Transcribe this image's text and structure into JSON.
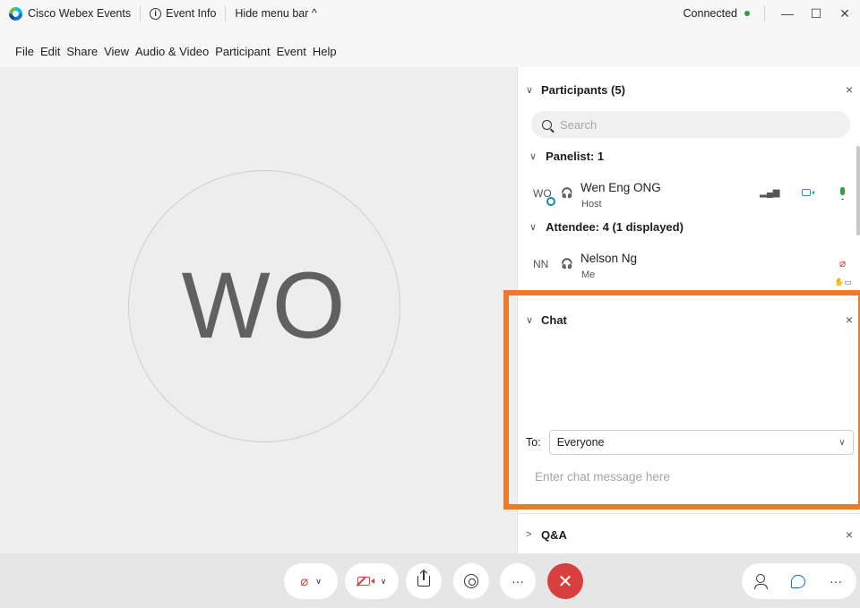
{
  "titlebar": {
    "app_name": "Cisco Webex Events",
    "event_info": "Event Info",
    "hide_menu": "Hide menu bar ^",
    "status": "Connected",
    "minimize": "—",
    "maximize": "☐",
    "close": "✕"
  },
  "menu": [
    "File",
    "Edit",
    "Share",
    "View",
    "Audio & Video",
    "Participant",
    "Event",
    "Help"
  ],
  "stage": {
    "avatar_initials": "WO"
  },
  "participants": {
    "title": "Participants (5)",
    "close": "×",
    "search_placeholder": "Search",
    "panelist_group": "Panelist: 1",
    "attendee_group": "Attendee: 4 (1 displayed)",
    "people": [
      {
        "initials": "WO",
        "name": "Wen Eng ONG",
        "role": "Host"
      },
      {
        "initials": "NN",
        "name": "Nelson Ng",
        "role": "Me"
      }
    ]
  },
  "chat": {
    "title": "Chat",
    "close": "×",
    "to_label": "To:",
    "to_value": "Everyone",
    "input_placeholder": "Enter chat message here"
  },
  "qa": {
    "title": "Q&A",
    "close": "×"
  },
  "controls": {
    "more": "···",
    "end": "✕"
  },
  "colors": {
    "highlight": "#ea7b2c",
    "end_button": "#d93f3f",
    "connected": "#2ea043",
    "accent": "#1170cf"
  }
}
